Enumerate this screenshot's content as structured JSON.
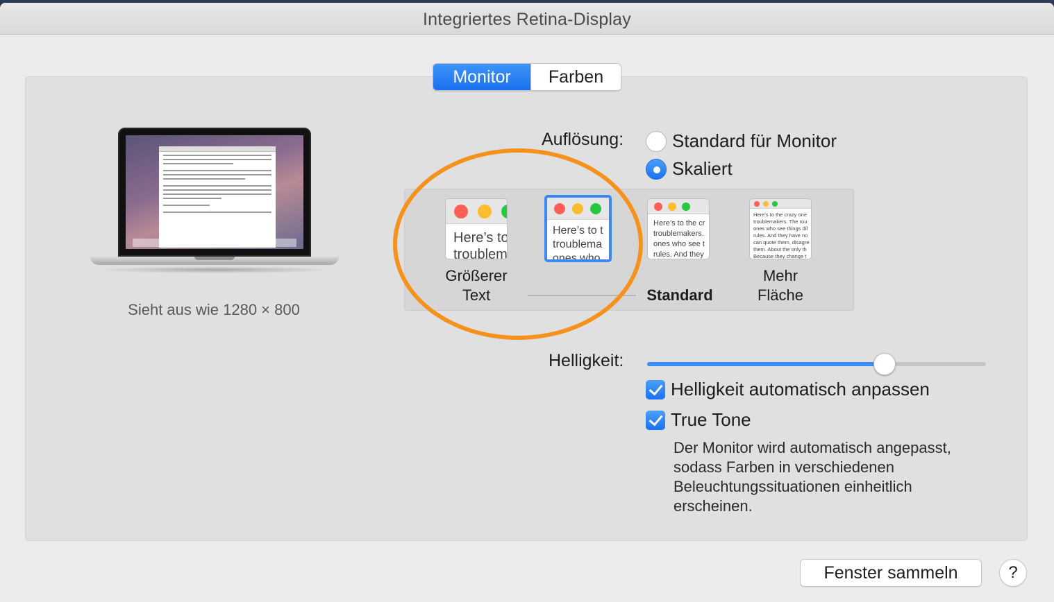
{
  "window": {
    "title": "Integriertes Retina-Display"
  },
  "tabs": [
    {
      "label": "Monitor",
      "active": true
    },
    {
      "label": "Farben",
      "active": false
    }
  ],
  "preview": {
    "looks_like": "Sieht aus wie 1280 × 800"
  },
  "resolution": {
    "label": "Auflösung:",
    "options": [
      {
        "label": "Standard für Monitor",
        "selected": false
      },
      {
        "label": "Skaliert",
        "selected": true
      }
    ]
  },
  "scaling": {
    "options": [
      {
        "caption_line1": "Größerer",
        "caption_line2": "Text",
        "preview_text": "Here’s to\ntroublem",
        "selected": false
      },
      {
        "caption_line1": "",
        "caption_line2": "",
        "preview_text": "Here’s to t\ntroublema\nones who",
        "selected": true
      },
      {
        "caption_line1": "",
        "caption_line2": "Standard",
        "preview_text": "Here’s to the cr\ntroublemakers.\nones who see t\nrules. And they",
        "selected": false
      },
      {
        "caption_line1": "Mehr",
        "caption_line2": "Fläche",
        "preview_text": "Here’s to the crazy one\ntroublemakers. The rou\nones who see things dif\nrules. And they have no\ncan quote them, disagre\nthem. About the only th\nBecause they change t",
        "selected": false
      }
    ]
  },
  "brightness": {
    "label": "Helligkeit:",
    "level": 0.7,
    "auto_label": "Helligkeit automatisch anpassen",
    "auto_checked": true
  },
  "true_tone": {
    "label": "True Tone",
    "checked": true,
    "description": "Der Monitor wird automatisch angepasst, sodass Farben in verschiedenen Beleuchtungssituationen einheitlich erscheinen."
  },
  "buttons": {
    "gather_windows": "Fenster sammeln",
    "help": "?"
  },
  "colors": {
    "accent": "#1b72ef",
    "highlight_circle": "#f5921e"
  }
}
